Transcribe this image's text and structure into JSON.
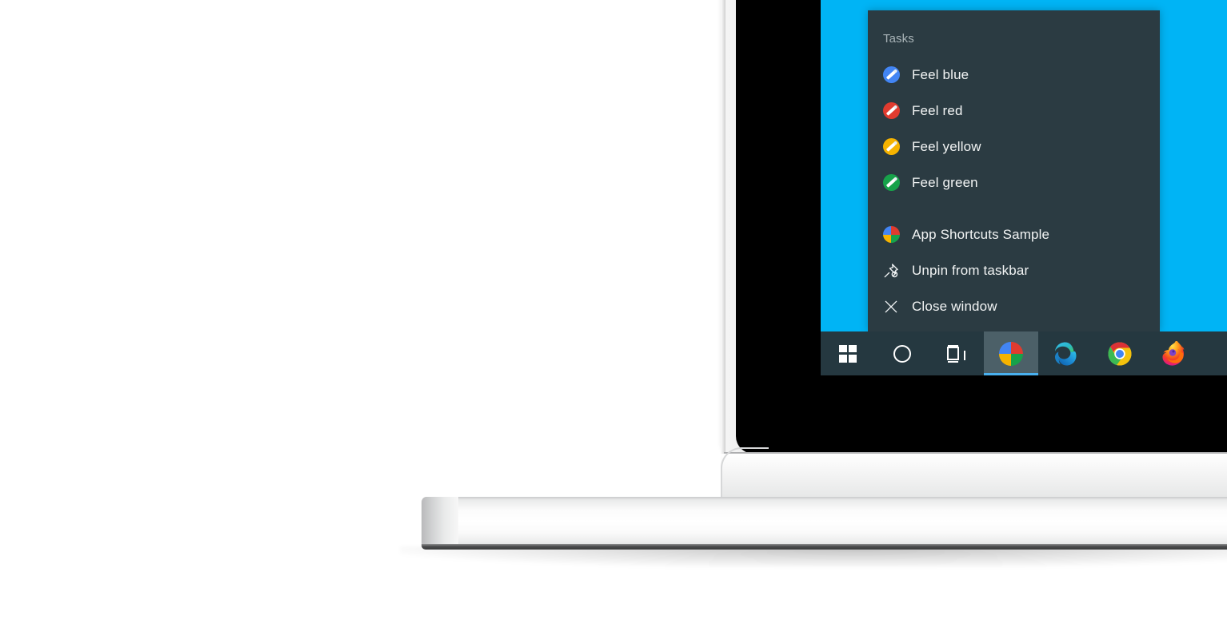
{
  "scene": {
    "device": "laptop",
    "wallpaper_color": "#00b4f5"
  },
  "jumplist": {
    "header": "Tasks",
    "background_color": "#2b3b42",
    "tasks": [
      {
        "label": "Feel blue",
        "icon": "brush-circle-icon",
        "color": "#4285f4"
      },
      {
        "label": "Feel red",
        "icon": "brush-circle-icon",
        "color": "#e03b2f"
      },
      {
        "label": "Feel yellow",
        "icon": "brush-circle-icon",
        "color": "#f6b300"
      },
      {
        "label": "Feel green",
        "icon": "brush-circle-icon",
        "color": "#17a24a"
      }
    ],
    "actions": [
      {
        "label": "App Shortcuts Sample",
        "icon": "app-pie-icon"
      },
      {
        "label": "Unpin from taskbar",
        "icon": "unpin-icon"
      },
      {
        "label": "Close window",
        "icon": "close-x-icon"
      }
    ]
  },
  "taskbar": {
    "background_color": "#253840",
    "accent_color": "#49b0ef",
    "items": [
      {
        "name": "start",
        "label": "Start",
        "icon": "windows-logo-icon",
        "active": false
      },
      {
        "name": "cortana",
        "label": "Cortana",
        "icon": "cortana-circle-icon",
        "active": false
      },
      {
        "name": "task-view",
        "label": "Task View",
        "icon": "task-view-icon",
        "active": false
      },
      {
        "name": "app-shortcuts-sample",
        "label": "App Shortcuts Sample",
        "icon": "app-pie-icon",
        "active": true
      },
      {
        "name": "edge",
        "label": "Microsoft Edge",
        "icon": "edge-icon",
        "active": false
      },
      {
        "name": "chrome",
        "label": "Google Chrome",
        "icon": "chrome-icon",
        "active": false
      },
      {
        "name": "firefox",
        "label": "Mozilla Firefox",
        "icon": "firefox-icon",
        "active": false
      }
    ]
  }
}
